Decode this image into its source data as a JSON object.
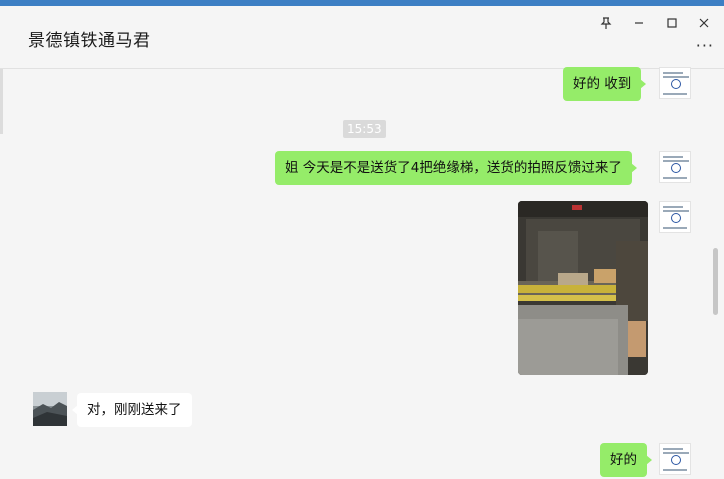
{
  "window": {
    "title": "景德镇铁通马君",
    "controls": {
      "pin": "pin-icon",
      "minimize": "minimize-icon",
      "maximize": "maximize-icon",
      "close": "close-icon",
      "more": "···"
    }
  },
  "messages": [
    {
      "sender": "me",
      "text": "好的  收到"
    },
    {
      "type": "time",
      "text": "15:53"
    },
    {
      "sender": "me",
      "text": "姐  今天是不是送货了4把绝缘梯，送货的拍照反馈过来了"
    },
    {
      "sender": "me",
      "type": "image",
      "image_desc": "warehouse-photo"
    },
    {
      "sender": "them",
      "text": "对，刚刚送来了"
    },
    {
      "sender": "me",
      "text": "好的"
    }
  ],
  "colors": {
    "my_bubble": "#95ec69",
    "their_bubble": "#ffffff",
    "background": "#f5f5f5",
    "accent_bar": "#3d7fc4"
  }
}
